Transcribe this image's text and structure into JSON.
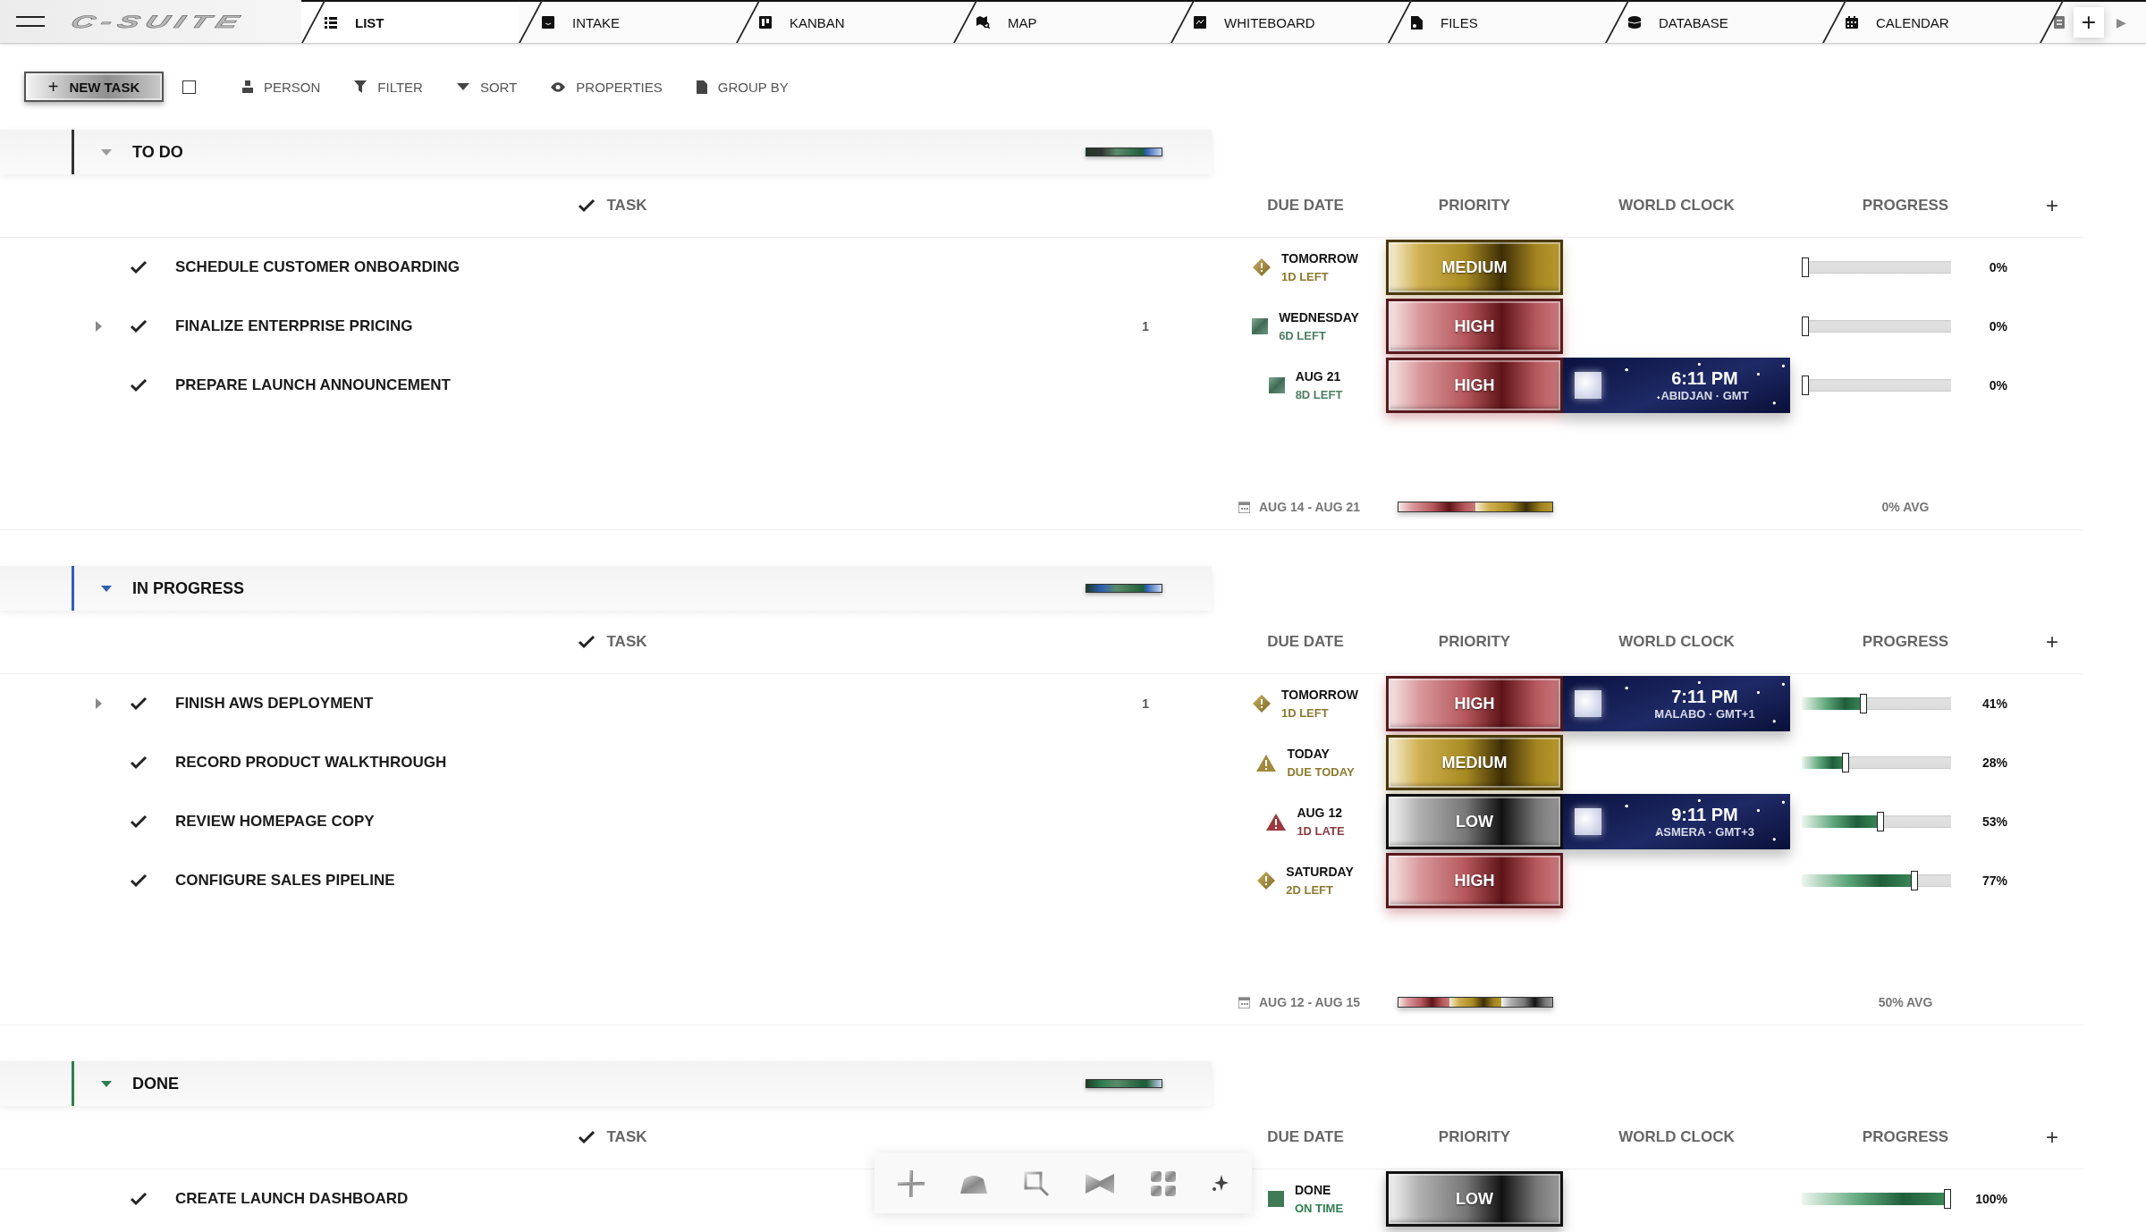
{
  "logo": "C-SUITE",
  "tabs": [
    {
      "kind": "list",
      "label": "LIST",
      "selected": true
    },
    {
      "kind": "intake",
      "label": "INTAKE",
      "selected": false
    },
    {
      "kind": "kanban",
      "label": "KANBAN",
      "selected": false
    },
    {
      "kind": "map",
      "label": "MAP",
      "selected": false
    },
    {
      "kind": "whiteboard",
      "label": "WHITEBOARD",
      "selected": false
    },
    {
      "kind": "files",
      "label": "FILES",
      "selected": false
    },
    {
      "kind": "database",
      "label": "DATABASE",
      "selected": false
    },
    {
      "kind": "calendar",
      "label": "CALENDAR",
      "selected": false
    }
  ],
  "add_tab": "+",
  "tabs_scroll": "▶",
  "toolbar": {
    "new_task": {
      "icon": "+",
      "label": "NEW TASK"
    },
    "select_all": {
      "checked": false
    },
    "actions": [
      {
        "kind": "person",
        "label": "PERSON"
      },
      {
        "kind": "filter",
        "label": "FILTER"
      },
      {
        "kind": "sort",
        "label": "SORT"
      },
      {
        "kind": "properties",
        "label": "PROPERTIES"
      },
      {
        "kind": "group",
        "label": "GROUP BY"
      }
    ]
  },
  "groups": [
    {
      "title": "TO DO",
      "expanded": true,
      "color": "#333333",
      "columns": {
        "task": "TASK",
        "due_date": "DUE DATE",
        "priority": "PRIORITY",
        "world_clock": "WORLD CLOCK",
        "progress": "PROGRESS",
        "add": "+"
      },
      "tasks": [
        {
          "title": "SCHEDULE CUSTOMER ONBOARDING",
          "due": {
            "kind": "soon",
            "date": "TOMORROW",
            "note": "1D LEFT"
          },
          "priority": {
            "kind": "medium",
            "label": "MEDIUM"
          },
          "progress": {
            "level": 0,
            "reading": "0%"
          }
        },
        {
          "title": "FINALIZE ENTERPRISE PRICING",
          "subtasks": {
            "count": "1",
            "expanded": false
          },
          "due": {
            "kind": "later",
            "date": "WEDNESDAY",
            "note": "6D LEFT"
          },
          "priority": {
            "kind": "high",
            "label": "HIGH"
          },
          "progress": {
            "level": 0,
            "reading": "0%"
          }
        },
        {
          "title": "PREPARE LAUNCH ANNOUNCEMENT",
          "due": {
            "kind": "later",
            "date": "AUG 21",
            "note": "8D LEFT"
          },
          "priority": {
            "kind": "high",
            "label": "HIGH"
          },
          "clock": {
            "time": "6:11 PM",
            "zone": "ABIDJAN · GMT"
          },
          "progress": {
            "level": 0,
            "reading": "0%"
          }
        }
      ],
      "footer": {
        "range": "AUG 14 - AUG 21",
        "priority_mix": [
          {
            "kind": "high"
          },
          {
            "kind": "medium"
          }
        ],
        "average": "0% AVG"
      }
    },
    {
      "title": "IN PROGRESS",
      "expanded": true,
      "color": "#2f5fb3",
      "columns": {
        "task": "TASK",
        "due_date": "DUE DATE",
        "priority": "PRIORITY",
        "world_clock": "WORLD CLOCK",
        "progress": "PROGRESS",
        "add": "+"
      },
      "tasks": [
        {
          "title": "FINISH AWS DEPLOYMENT",
          "subtasks": {
            "count": "1",
            "expanded": false
          },
          "due": {
            "kind": "soon",
            "date": "TOMORROW",
            "note": "1D LEFT"
          },
          "priority": {
            "kind": "high",
            "label": "HIGH"
          },
          "clock": {
            "time": "7:11 PM",
            "zone": "MALABO · GMT+1"
          },
          "progress": {
            "level": 0.41,
            "reading": "41%"
          }
        },
        {
          "title": "RECORD PRODUCT WALKTHROUGH",
          "due": {
            "kind": "today",
            "date": "TODAY",
            "note": "DUE TODAY"
          },
          "priority": {
            "kind": "medium",
            "label": "MEDIUM"
          },
          "progress": {
            "level": 0.28,
            "reading": "28%"
          }
        },
        {
          "title": "REVIEW HOMEPAGE COPY",
          "due": {
            "kind": "late",
            "date": "AUG 12",
            "note": "1D LATE"
          },
          "priority": {
            "kind": "low",
            "label": "LOW"
          },
          "clock": {
            "time": "9:11 PM",
            "zone": "ASMERA · GMT+3"
          },
          "progress": {
            "level": 0.53,
            "reading": "53%"
          }
        },
        {
          "title": "CONFIGURE SALES PIPELINE",
          "due": {
            "kind": "soon",
            "date": "SATURDAY",
            "note": "2D LEFT"
          },
          "priority": {
            "kind": "high",
            "label": "HIGH"
          },
          "progress": {
            "level": 0.77,
            "reading": "77%"
          }
        }
      ],
      "footer": {
        "range": "AUG 12 - AUG 15",
        "priority_mix": [
          {
            "kind": "high"
          },
          {
            "kind": "medium"
          },
          {
            "kind": "low"
          }
        ],
        "average": "50% AVG"
      }
    },
    {
      "title": "DONE",
      "expanded": true,
      "color": "#2e7d4f",
      "columns": {
        "task": "TASK",
        "due_date": "DUE DATE",
        "priority": "PRIORITY",
        "world_clock": "WORLD CLOCK",
        "progress": "PROGRESS",
        "add": "+"
      },
      "tasks": [
        {
          "title": "CREATE LAUNCH DASHBOARD",
          "due": {
            "kind": "done",
            "date": "DONE",
            "note": "ON TIME"
          },
          "priority": {
            "kind": "low",
            "label": "LOW"
          },
          "progress": {
            "level": 1,
            "reading": "100%"
          }
        }
      ]
    }
  ]
}
